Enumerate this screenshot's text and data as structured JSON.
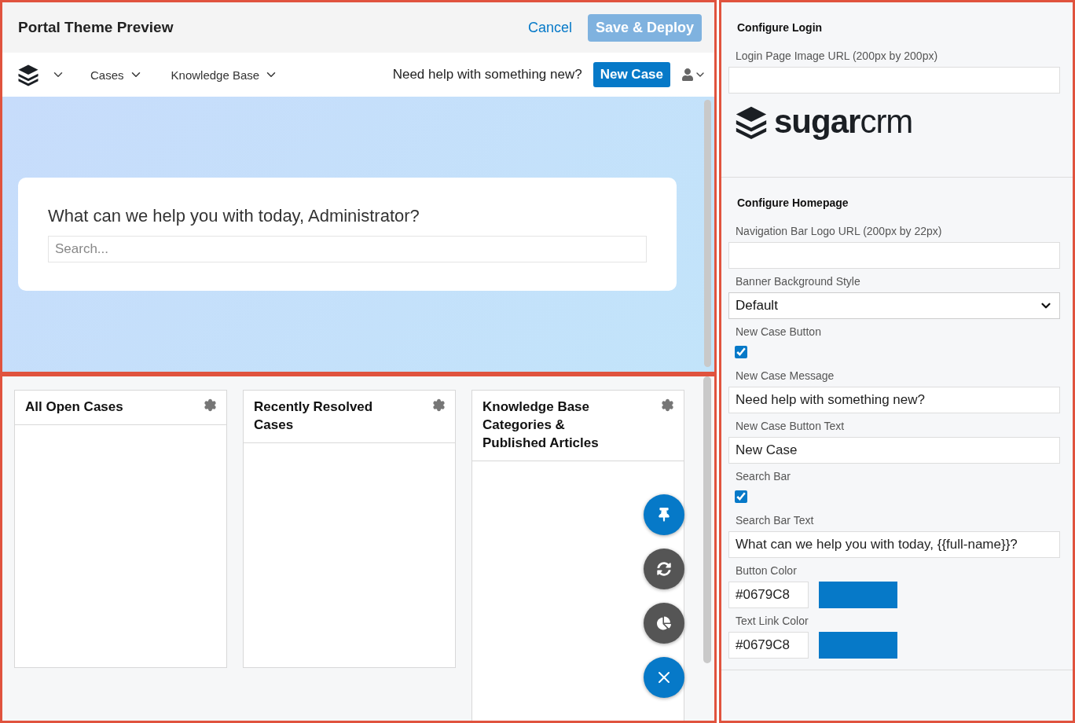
{
  "preview": {
    "title": "Portal Theme Preview",
    "cancel": "Cancel",
    "save": "Save & Deploy",
    "nav": {
      "menus": [
        {
          "label": "Cases"
        },
        {
          "label": "Knowledge Base"
        }
      ],
      "message": "Need help with something new?",
      "new_case": "New Case"
    },
    "banner": {
      "heading": "What can we help you with today, Administrator?",
      "search_placeholder": "Search..."
    }
  },
  "dashlets": [
    {
      "title": "All Open Cases"
    },
    {
      "title": "Recently Resolved Cases"
    },
    {
      "title": "Knowledge Base Categories & Published Articles"
    }
  ],
  "fabs": [
    {
      "kind": "pin",
      "color": "#0679c8"
    },
    {
      "kind": "refresh",
      "color": "#555555"
    },
    {
      "kind": "chart",
      "color": "#555555"
    },
    {
      "kind": "close",
      "color": "#0679c8"
    }
  ],
  "config": {
    "sections": [
      {
        "title": "Configure Login",
        "fields": [
          {
            "kind": "text",
            "label": "Login Page Image URL (200px by 200px)"
          },
          {
            "kind": "logo",
            "text": "**sugar**crm"
          }
        ]
      },
      {
        "title": "Configure Homepage",
        "fields": [
          {
            "kind": "text",
            "label": "Navigation Bar Logo URL (200px by 22px)"
          },
          {
            "kind": "select",
            "label": "Banner Background Style",
            "value": "Default"
          },
          {
            "kind": "checkbox",
            "label": "New Case Button",
            "checked": true
          },
          {
            "kind": "text",
            "label": "New Case Message",
            "value": "Need help with something new?"
          },
          {
            "kind": "text",
            "label": "New Case Button Text",
            "value": "New Case"
          },
          {
            "kind": "checkbox",
            "label": "Search Bar",
            "checked": true
          },
          {
            "kind": "text",
            "label": "Search Bar Text",
            "value": "What can we help you with today, {{full-name}}?"
          },
          {
            "kind": "color",
            "label": "Button Color",
            "value": "#0679C8",
            "color": "#0679c8"
          },
          {
            "kind": "color",
            "label": "Text Link Color",
            "value": "#0679C8",
            "color": "#0679c8"
          }
        ]
      }
    ]
  }
}
